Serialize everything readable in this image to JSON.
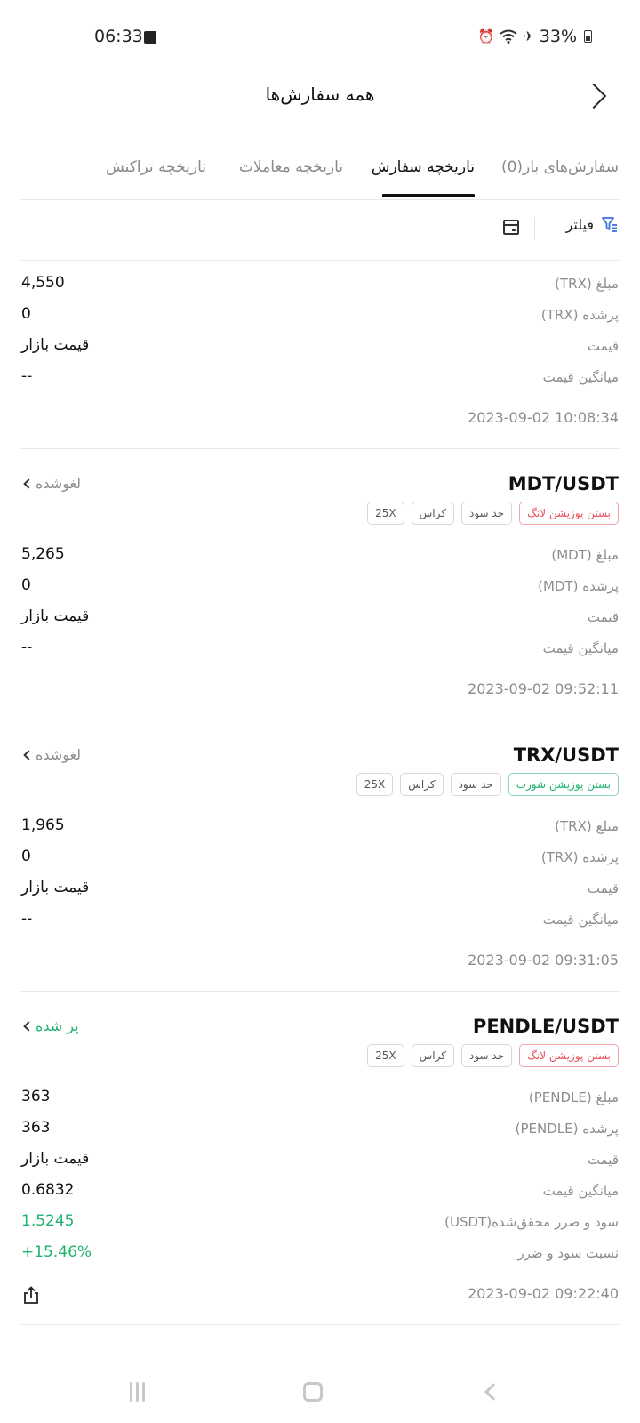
{
  "status_bar": {
    "time": "06:33",
    "battery": "33%"
  },
  "header": {
    "title": "همه سفارش‌ها"
  },
  "tabs": [
    {
      "label": "سفارش‌های باز(0)"
    },
    {
      "label": "تاریخچه سفارش"
    },
    {
      "label": "تاریخچه معاملات"
    },
    {
      "label": "تاریخچه تراکنش"
    }
  ],
  "toolbar": {
    "filter_label": "فیلتر"
  },
  "orders": [
    {
      "rows": [
        {
          "label": "مبلغ (TRX)",
          "value": "4,550"
        },
        {
          "label": "پرشده (TRX)",
          "value": "0"
        },
        {
          "label": "قیمت",
          "value": "قیمت بازار"
        },
        {
          "label": "میانگین قیمت",
          "value": "--"
        }
      ],
      "timestamp": "2023-09-02 10:08:34"
    },
    {
      "pair": "MDT/USDT",
      "status": "لغوشده",
      "tags": [
        "بستن پوزیشن لانگ",
        "حد سود",
        "کراس",
        "25X"
      ],
      "rows": [
        {
          "label": "مبلغ (MDT)",
          "value": "5,265"
        },
        {
          "label": "پرشده (MDT)",
          "value": "0"
        },
        {
          "label": "قیمت",
          "value": "قیمت بازار"
        },
        {
          "label": "میانگین قیمت",
          "value": "--"
        }
      ],
      "timestamp": "2023-09-02 09:52:11"
    },
    {
      "pair": "TRX/USDT",
      "status": "لغوشده",
      "tags": [
        "بستن پوزیشن شورت",
        "حد سود",
        "کراس",
        "25X"
      ],
      "rows": [
        {
          "label": "مبلغ (TRX)",
          "value": "1,965"
        },
        {
          "label": "پرشده (TRX)",
          "value": "0"
        },
        {
          "label": "قیمت",
          "value": "قیمت بازار"
        },
        {
          "label": "میانگین قیمت",
          "value": "--"
        }
      ],
      "timestamp": "2023-09-02 09:31:05"
    },
    {
      "pair": "PENDLE/USDT",
      "status": "پر شده",
      "tags": [
        "بستن پوزیشن لانگ",
        "حد سود",
        "کراس",
        "25X"
      ],
      "rows": [
        {
          "label": "مبلغ (PENDLE)",
          "value": "363"
        },
        {
          "label": "پرشده (PENDLE)",
          "value": "363"
        },
        {
          "label": "قیمت",
          "value": "قیمت بازار"
        },
        {
          "label": "میانگین قیمت",
          "value": "0.6832"
        },
        {
          "label": "سود و ضرر محقق‌شده(USDT)",
          "value": "1.5245"
        },
        {
          "label": "نسبت سود و ضرر",
          "value": "+15.46%"
        }
      ],
      "timestamp": "2023-09-02 09:22:40"
    }
  ],
  "colors": {
    "green": "#21b36e",
    "red": "#e8505b",
    "muted": "#8c8c8c"
  }
}
